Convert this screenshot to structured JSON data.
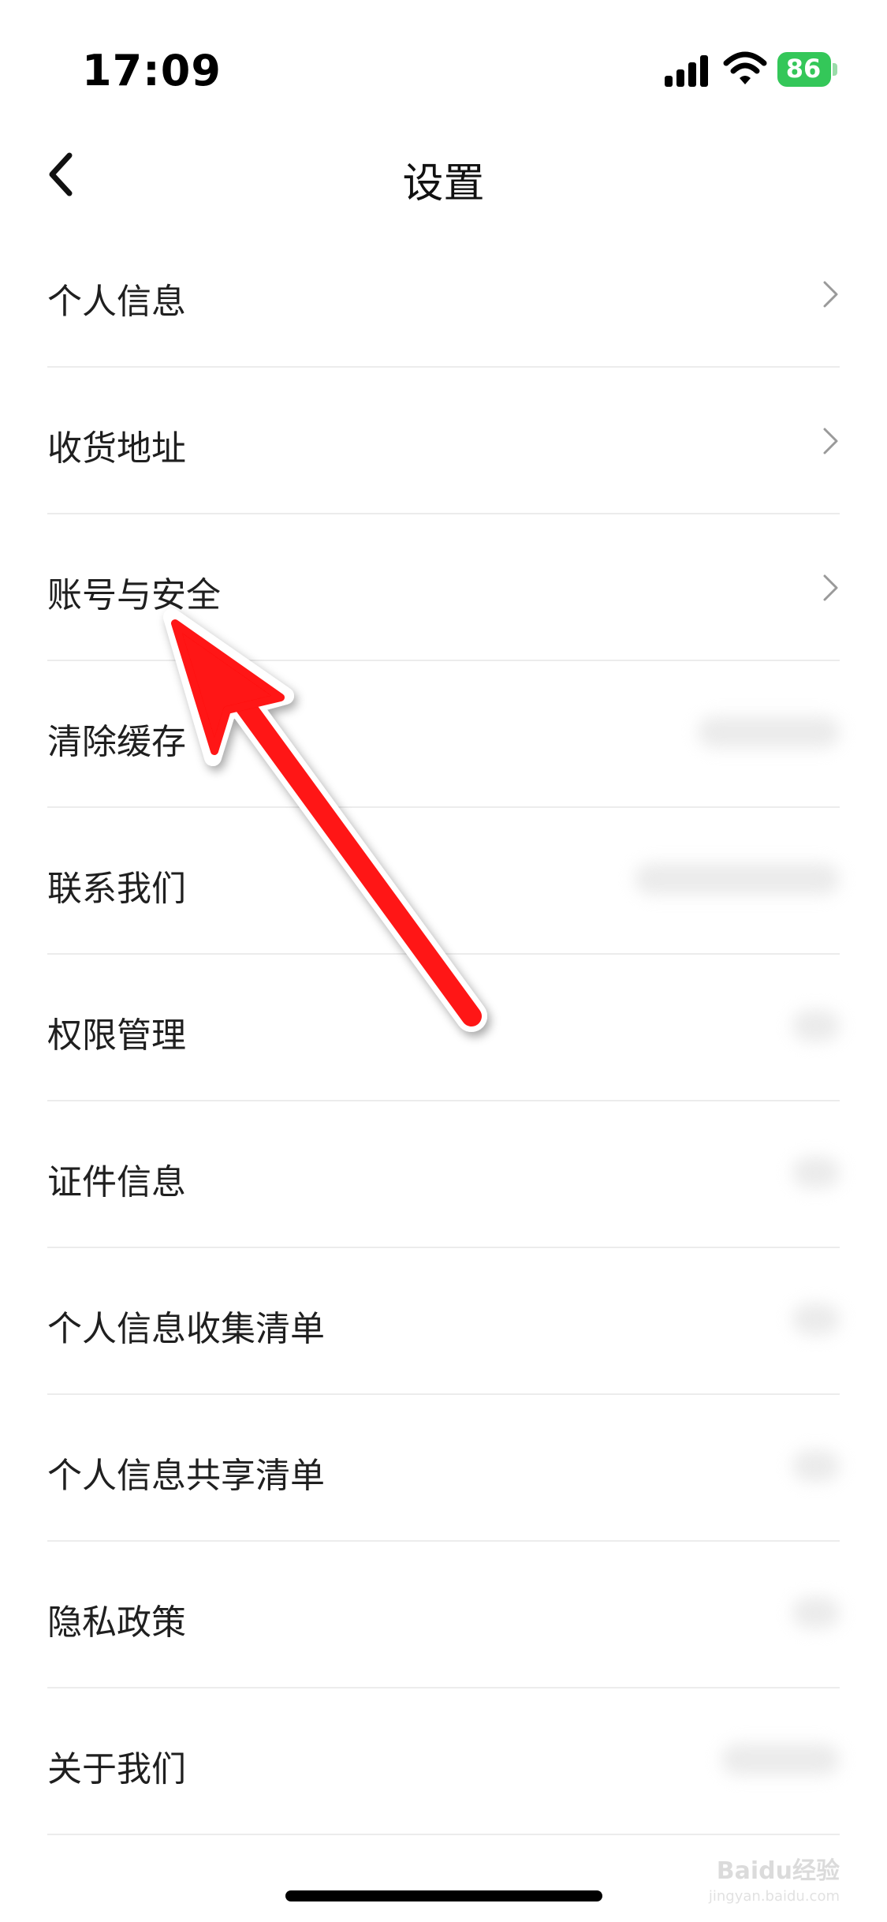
{
  "status_bar": {
    "time": "17:09",
    "battery": "86",
    "battery_color": "#34c759",
    "signal_icon": "cellular-signal-icon",
    "wifi_icon": "wifi-icon"
  },
  "nav": {
    "title": "设置",
    "back_icon": "chevron-left-icon"
  },
  "settings": [
    {
      "label": "个人信息",
      "chevron": true
    },
    {
      "label": "收货地址",
      "chevron": true
    },
    {
      "label": "账号与安全",
      "chevron": true
    },
    {
      "label": "清除缓存",
      "value_blurred": true
    },
    {
      "label": "联系我们",
      "value_blurred": true
    },
    {
      "label": "权限管理",
      "value_blurred": true
    },
    {
      "label": "证件信息",
      "value_blurred": true
    },
    {
      "label": "个人信息收集清单",
      "value_blurred": true
    },
    {
      "label": "个人信息共享清单",
      "value_blurred": true
    },
    {
      "label": "隐私政策",
      "value_blurred": true
    },
    {
      "label": "关于我们",
      "value_blurred": true
    }
  ],
  "annotation": {
    "type": "red-arrow",
    "color": "#ff1a1a",
    "target": "账号与安全"
  },
  "watermark": {
    "text": "Baidu经验",
    "sub": "jingyan.baidu.com"
  }
}
